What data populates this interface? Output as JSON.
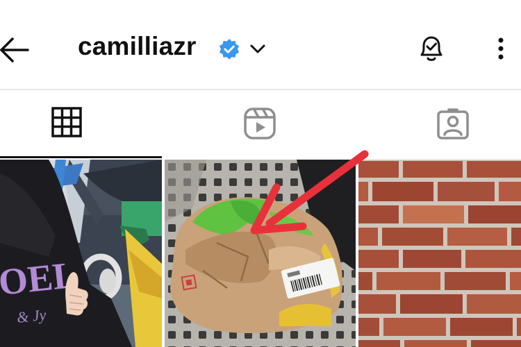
{
  "header": {
    "username": "camilliazr",
    "icons": {
      "back": "arrow-left-icon",
      "verified": "verified-badge-icon",
      "dropdown": "chevron-down-icon",
      "notifications": "bell-check-icon",
      "more": "more-vertical-icon"
    }
  },
  "tabs": [
    {
      "name": "posts",
      "icon": "grid-icon",
      "active": true
    },
    {
      "name": "reels",
      "icon": "reels-icon",
      "active": false
    },
    {
      "name": "tagged",
      "icon": "tagged-user-icon",
      "active": false
    }
  ],
  "posts": [
    {
      "subject": "person-in-hoodie-thumbs-up",
      "caption_visible": false
    },
    {
      "subject": "crumpled-paper-bag-on-seat",
      "caption_visible": false
    },
    {
      "subject": "brick-wall",
      "caption_visible": false
    }
  ],
  "colors": {
    "verified_blue": "#3897f0",
    "annotation_arrow": "#e8313a",
    "text": "#111111"
  }
}
